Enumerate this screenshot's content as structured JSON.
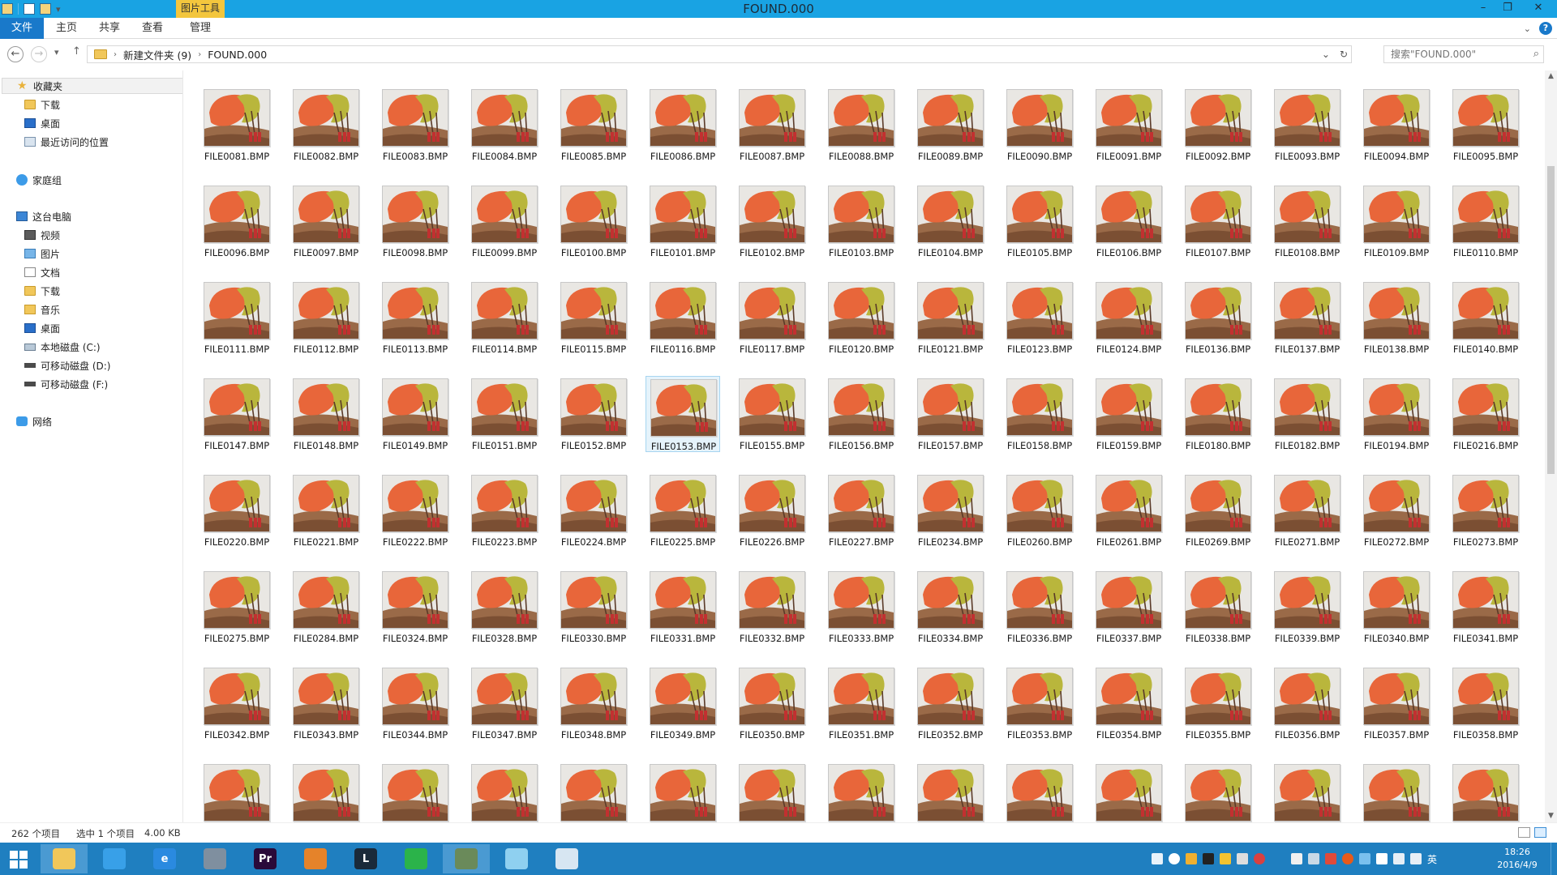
{
  "window": {
    "title": "FOUND.000",
    "context_tab": "图片工具",
    "controls": [
      "–",
      "❐",
      "✕"
    ]
  },
  "ribbon": {
    "tabs": [
      "文件",
      "主页",
      "共享",
      "查看",
      "管理"
    ]
  },
  "address": {
    "crumbs": [
      "新建文件夹 (9)",
      "FOUND.000"
    ],
    "search_placeholder": "搜索\"FOUND.000\""
  },
  "nav": {
    "favorites": "收藏夹",
    "fav_items": [
      "下载",
      "桌面",
      "最近访问的位置"
    ],
    "homegroup": "家庭组",
    "this_pc": "这台电脑",
    "pc_items": [
      "视频",
      "图片",
      "文档",
      "下载",
      "音乐",
      "桌面",
      "本地磁盘 (C:)",
      "可移动磁盘 (D:)",
      "可移动磁盘 (F:)"
    ],
    "network": "网络"
  },
  "files": [
    "FILE0081.BMP",
    "FILE0082.BMP",
    "FILE0083.BMP",
    "FILE0084.BMP",
    "FILE0085.BMP",
    "FILE0086.BMP",
    "FILE0087.BMP",
    "FILE0088.BMP",
    "FILE0089.BMP",
    "FILE0090.BMP",
    "FILE0091.BMP",
    "FILE0092.BMP",
    "FILE0093.BMP",
    "FILE0094.BMP",
    "FILE0095.BMP",
    "FILE0096.BMP",
    "FILE0097.BMP",
    "FILE0098.BMP",
    "FILE0099.BMP",
    "FILE0100.BMP",
    "FILE0101.BMP",
    "FILE0102.BMP",
    "FILE0103.BMP",
    "FILE0104.BMP",
    "FILE0105.BMP",
    "FILE0106.BMP",
    "FILE0107.BMP",
    "FILE0108.BMP",
    "FILE0109.BMP",
    "FILE0110.BMP",
    "FILE0111.BMP",
    "FILE0112.BMP",
    "FILE0113.BMP",
    "FILE0114.BMP",
    "FILE0115.BMP",
    "FILE0116.BMP",
    "FILE0117.BMP",
    "FILE0120.BMP",
    "FILE0121.BMP",
    "FILE0123.BMP",
    "FILE0124.BMP",
    "FILE0136.BMP",
    "FILE0137.BMP",
    "FILE0138.BMP",
    "FILE0140.BMP",
    "FILE0147.BMP",
    "FILE0148.BMP",
    "FILE0149.BMP",
    "FILE0151.BMP",
    "FILE0152.BMP",
    "FILE0153.BMP",
    "FILE0155.BMP",
    "FILE0156.BMP",
    "FILE0157.BMP",
    "FILE0158.BMP",
    "FILE0159.BMP",
    "FILE0180.BMP",
    "FILE0182.BMP",
    "FILE0194.BMP",
    "FILE0216.BMP",
    "FILE0220.BMP",
    "FILE0221.BMP",
    "FILE0222.BMP",
    "FILE0223.BMP",
    "FILE0224.BMP",
    "FILE0225.BMP",
    "FILE0226.BMP",
    "FILE0227.BMP",
    "FILE0234.BMP",
    "FILE0260.BMP",
    "FILE0261.BMP",
    "FILE0269.BMP",
    "FILE0271.BMP",
    "FILE0272.BMP",
    "FILE0273.BMP",
    "FILE0275.BMP",
    "FILE0284.BMP",
    "FILE0324.BMP",
    "FILE0328.BMP",
    "FILE0330.BMP",
    "FILE0331.BMP",
    "FILE0332.BMP",
    "FILE0333.BMP",
    "FILE0334.BMP",
    "FILE0336.BMP",
    "FILE0337.BMP",
    "FILE0338.BMP",
    "FILE0339.BMP",
    "FILE0340.BMP",
    "FILE0341.BMP",
    "FILE0342.BMP",
    "FILE0343.BMP",
    "FILE0344.BMP",
    "FILE0347.BMP",
    "FILE0348.BMP",
    "FILE0349.BMP",
    "FILE0350.BMP",
    "FILE0351.BMP",
    "FILE0352.BMP",
    "FILE0353.BMP",
    "FILE0354.BMP",
    "FILE0355.BMP",
    "FILE0356.BMP",
    "FILE0357.BMP",
    "FILE0358.BMP",
    "",
    "",
    "",
    "",
    "",
    "",
    "",
    "",
    "",
    "",
    "",
    "",
    "",
    "",
    ""
  ],
  "selected_file": "FILE0153.BMP",
  "status": {
    "count": "262 个项目",
    "selection": "选中 1 个项目",
    "size": "4.00 KB"
  },
  "taskbar": {
    "apps": [
      {
        "name": "file-explorer",
        "label": "",
        "color": "#f1c75a",
        "active": true
      },
      {
        "name": "baidu-netdisk",
        "label": "",
        "color": "#38a0e8",
        "active": false
      },
      {
        "name": "internet-explorer",
        "label": "e",
        "color": "#2a8ae0",
        "active": false
      },
      {
        "name": "remote-desktop",
        "label": "",
        "color": "#7f8f9f",
        "active": false
      },
      {
        "name": "premiere-pro",
        "label": "Pr",
        "color": "#2a0a3a",
        "active": false
      },
      {
        "name": "browser",
        "label": "",
        "color": "#e5832a",
        "active": false
      },
      {
        "name": "league-of-legends",
        "label": "L",
        "color": "#1a2a3a",
        "active": false
      },
      {
        "name": "wechat",
        "label": "",
        "color": "#2bb34a",
        "active": false
      },
      {
        "name": "photo-viewer",
        "label": "",
        "color": "#6a8a5a",
        "active": true
      },
      {
        "name": "notes-app",
        "label": "",
        "color": "#8fd0f0",
        "active": false
      },
      {
        "name": "paint-app",
        "label": "",
        "color": "#d7e6f2",
        "active": false
      }
    ],
    "ime": "英",
    "time": "18:26",
    "date": "2016/4/9"
  }
}
